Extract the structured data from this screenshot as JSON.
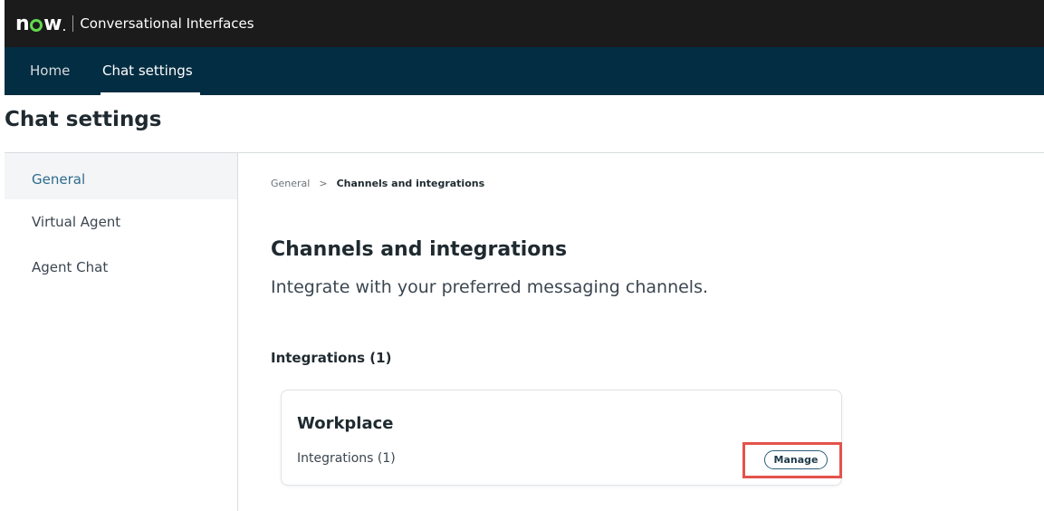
{
  "header": {
    "logo_text": "now",
    "app_title": "Conversational Interfaces"
  },
  "nav": {
    "tabs": [
      {
        "label": "Home",
        "active": false
      },
      {
        "label": "Chat settings",
        "active": true
      }
    ]
  },
  "page": {
    "title": "Chat settings"
  },
  "sidebar": {
    "items": [
      {
        "label": "General",
        "active": true
      },
      {
        "label": "Virtual Agent",
        "active": false
      },
      {
        "label": "Agent Chat",
        "active": false
      }
    ]
  },
  "breadcrumb": {
    "parent": "General",
    "separator": ">",
    "current": "Channels and integrations"
  },
  "content": {
    "title": "Channels and integrations",
    "subtitle": "Integrate with your preferred messaging channels.",
    "group_title": "Integrations (1)",
    "card": {
      "title": "Workplace",
      "subtitle": "Integrations (1)",
      "button_label": "Manage"
    }
  },
  "colors": {
    "topbar": "#1b1b1b",
    "navbar": "#032d42",
    "logo_accent": "#62d84e",
    "active_sidebar_text": "#2d6b8f",
    "highlight_box": "#e3534b"
  }
}
